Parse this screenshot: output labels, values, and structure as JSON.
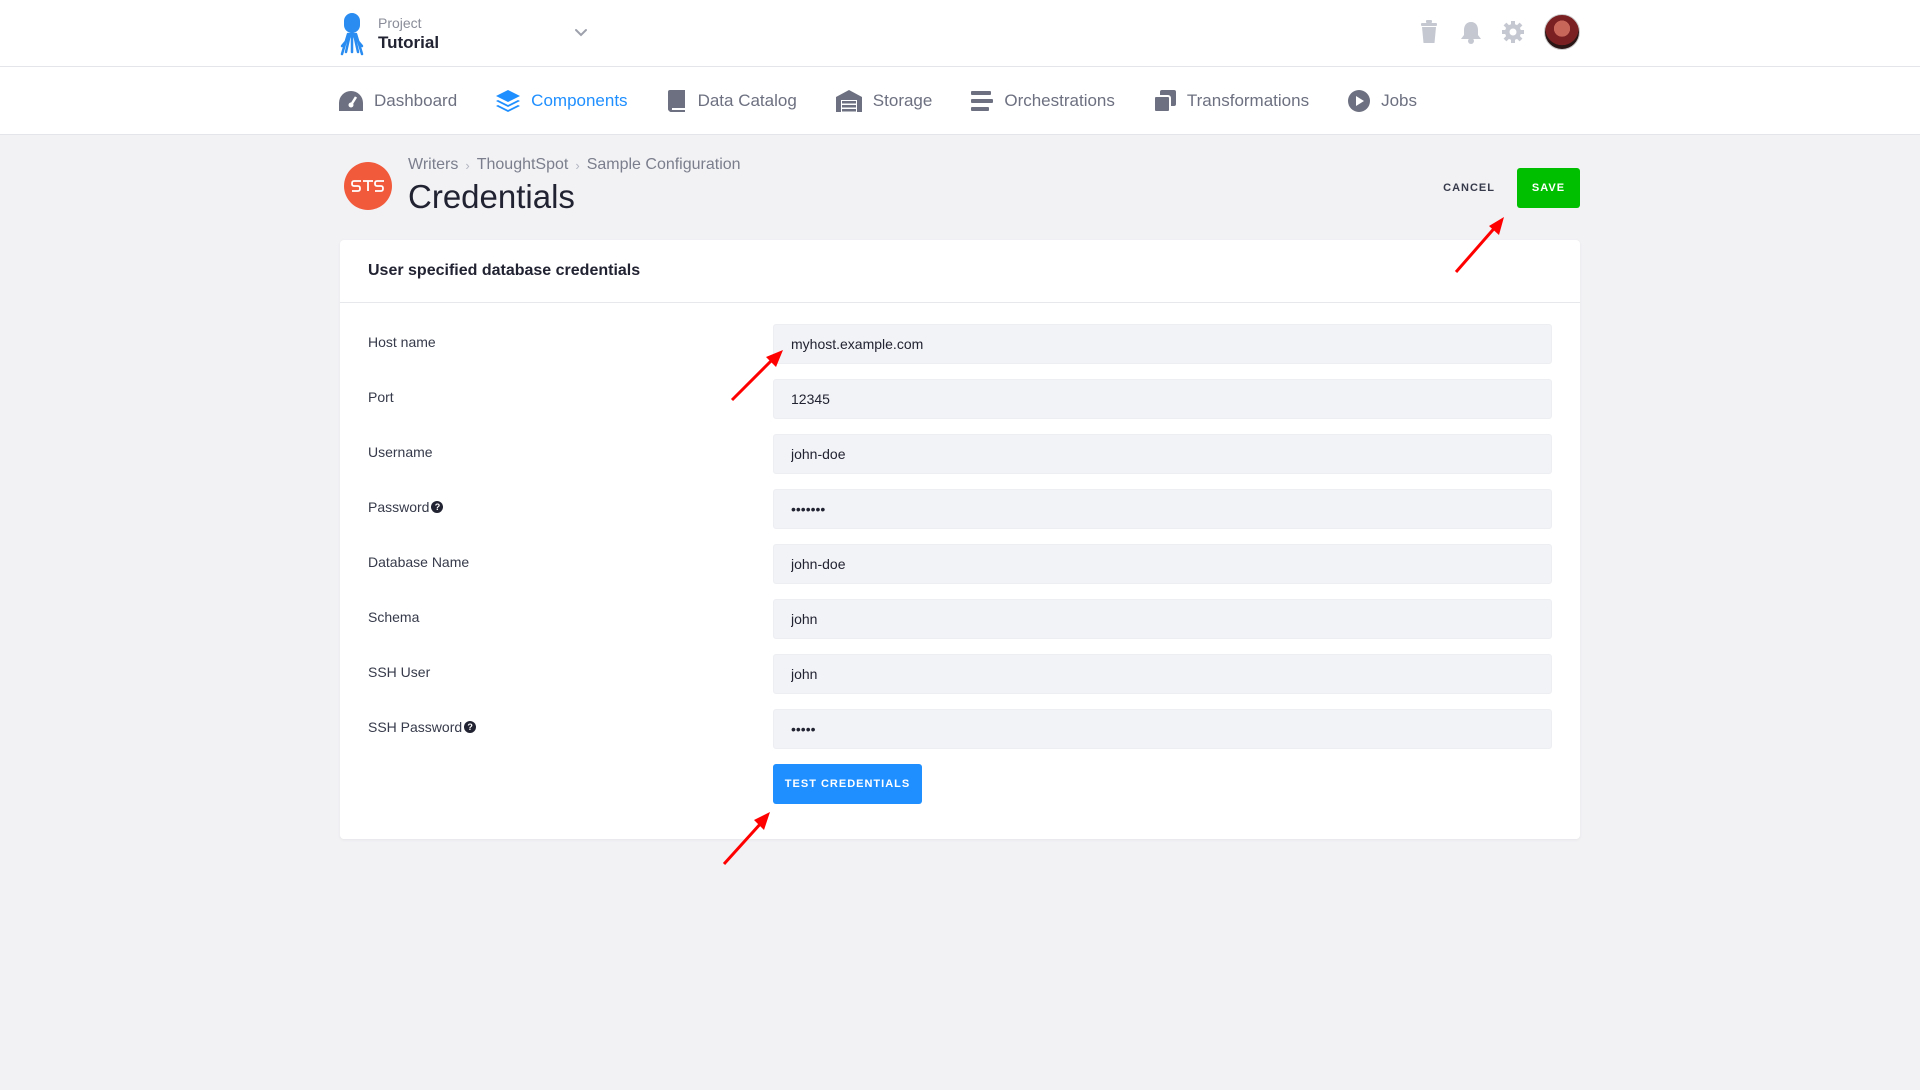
{
  "project": {
    "label": "Project",
    "name": "Tutorial"
  },
  "top_icons": [
    "trash-icon",
    "bell-icon",
    "gear-icon",
    "avatar"
  ],
  "nav": {
    "items": [
      {
        "label": "Dashboard",
        "icon": "speedometer-icon",
        "active": false
      },
      {
        "label": "Components",
        "icon": "layers-icon",
        "active": true
      },
      {
        "label": "Data Catalog",
        "icon": "book-icon",
        "active": false
      },
      {
        "label": "Storage",
        "icon": "warehouse-icon",
        "active": false
      },
      {
        "label": "Orchestrations",
        "icon": "bars-icon",
        "active": false
      },
      {
        "label": "Transformations",
        "icon": "copy-icon",
        "active": false
      },
      {
        "label": "Jobs",
        "icon": "play-circle-icon",
        "active": false
      }
    ]
  },
  "breadcrumb": {
    "items": [
      "Writers",
      "ThoughtSpot",
      "Sample Configuration"
    ]
  },
  "page": {
    "title": "Credentials"
  },
  "actions": {
    "cancel": "CANCEL",
    "save": "SAVE"
  },
  "card": {
    "title": "User specified database credentials",
    "fields": [
      {
        "label": "Host name",
        "value": "myhost.example.com",
        "help": false,
        "type": "text"
      },
      {
        "label": "Port",
        "value": "12345",
        "help": false,
        "type": "text"
      },
      {
        "label": "Username",
        "value": "john-doe",
        "help": false,
        "type": "text"
      },
      {
        "label": "Password",
        "value": "•••••••",
        "help": true,
        "type": "password"
      },
      {
        "label": "Database Name",
        "value": "john-doe",
        "help": false,
        "type": "text"
      },
      {
        "label": "Schema",
        "value": "john",
        "help": false,
        "type": "text"
      },
      {
        "label": "SSH User",
        "value": "john",
        "help": false,
        "type": "text"
      },
      {
        "label": "SSH Password",
        "value": "•••••",
        "help": true,
        "type": "password"
      }
    ],
    "test_button": "TEST CREDENTIALS"
  },
  "colors": {
    "accent": "#1f8fff",
    "save": "#00bf00",
    "annotation_arrow": "#ff0000",
    "component_logo": "#f25a3c"
  }
}
